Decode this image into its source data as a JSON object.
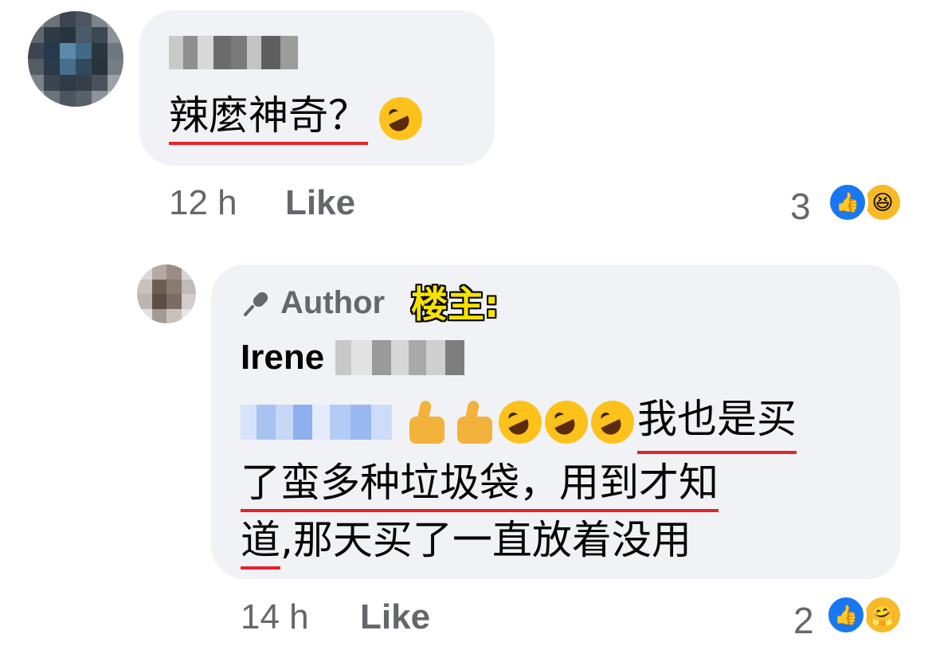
{
  "comment1": {
    "text": "辣麼神奇？",
    "time": "12 h",
    "like_label": "Like",
    "reaction_count": "3",
    "reactions": [
      "like-icon",
      "haha-icon"
    ]
  },
  "comment2": {
    "author_badge": "Author",
    "annotation": "楼主:",
    "author_first_name": "Irene",
    "text_line1": "我也是买",
    "text_line2": "了蛮多种垃圾袋，用到才知",
    "text_line3_underlined": "道",
    "text_line3_rest": ",那天买了一直放着没用",
    "time": "14 h",
    "like_label": "Like",
    "reaction_count": "2",
    "reactions": [
      "like-icon",
      "care-icon"
    ]
  },
  "colors": {
    "bubble": "#f0f2f5",
    "meta_text": "#65676b",
    "underline": "#e3232b",
    "like_blue": "#1877f2",
    "annotation_yellow": "#f6e200"
  }
}
